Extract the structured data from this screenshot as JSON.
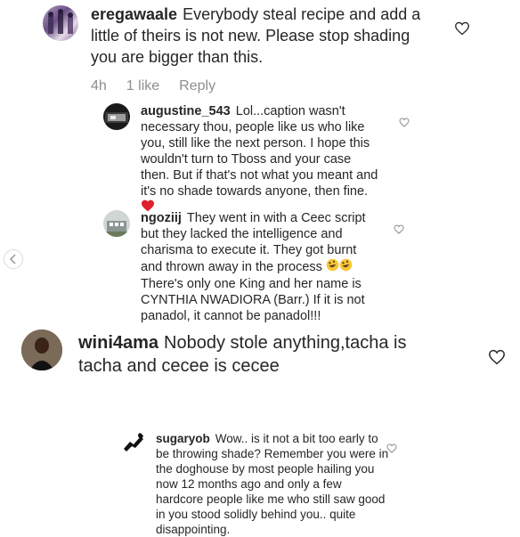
{
  "comments": [
    {
      "username": "eregawaale",
      "text": "Everybody steal recipe and add a little of theirs is not new. Please stop shading you are bigger than this.",
      "time": "4h",
      "likes": "1 like",
      "reply": "Reply"
    },
    {
      "username": "augustine_543",
      "text": "Lol...caption wasn't necessary thou, people like us who like you, still like the next person. I hope this wouldn't turn to Tboss and your case then. But if that's not what you meant and it's no shade towards anyone, then fine."
    },
    {
      "username": "ngoziij",
      "text": "They went in with a Ceec script but they lacked the intelligence and charisma to execute it. They got burnt and thrown away in the process",
      "text2": "There's only one King and her name is CYNTHIA NWADIORA (Barr.) If it is not panadol, it cannot be panadol!!!"
    },
    {
      "username": "wini4ama",
      "text": "Nobody stole anything,tacha is tacha and cecee is cecee"
    },
    {
      "username": "sugaryob",
      "text": "Wow.. is it not a bit too early to be throwing shade? Remember you were in the doghouse by most people hailing you now 12 months ago and only a few hardcore people like me who still saw good in you stood solidly behind you.. quite disappointing."
    }
  ],
  "icons": {
    "heart": "heart-outline-icon",
    "red_heart": "red-heart-emoji",
    "laugh": "rolling-laughing-emoji",
    "arrow": "chevron-left-icon"
  }
}
